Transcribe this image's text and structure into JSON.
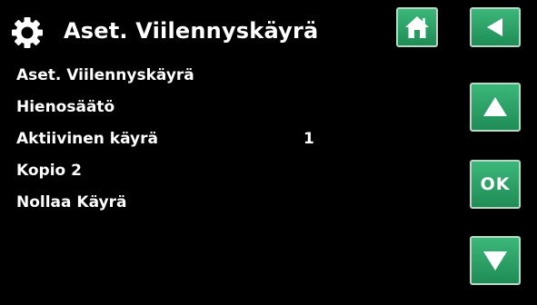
{
  "header": {
    "title": "Aset. Viilennyskäyrä",
    "title_icon": "gear-icon"
  },
  "nav": {
    "home_icon": "home-icon",
    "back_icon": "back-arrow-icon",
    "up_icon": "arrow-up-icon",
    "ok_label": "OK",
    "down_icon": "arrow-down-icon"
  },
  "menu": {
    "items": [
      {
        "label": "Aset. Viilennyskäyrä",
        "value": ""
      },
      {
        "label": "Hienosäätö",
        "value": ""
      },
      {
        "label": "Aktiivinen käyrä",
        "value": "1"
      },
      {
        "label": "Kopio 2",
        "value": ""
      },
      {
        "label": "Nollaa Käyrä",
        "value": ""
      }
    ]
  },
  "colors": {
    "background": "#000000",
    "text": "#ffffff",
    "button_green": "#2aa66a",
    "button_border": "#b8d9c5"
  }
}
